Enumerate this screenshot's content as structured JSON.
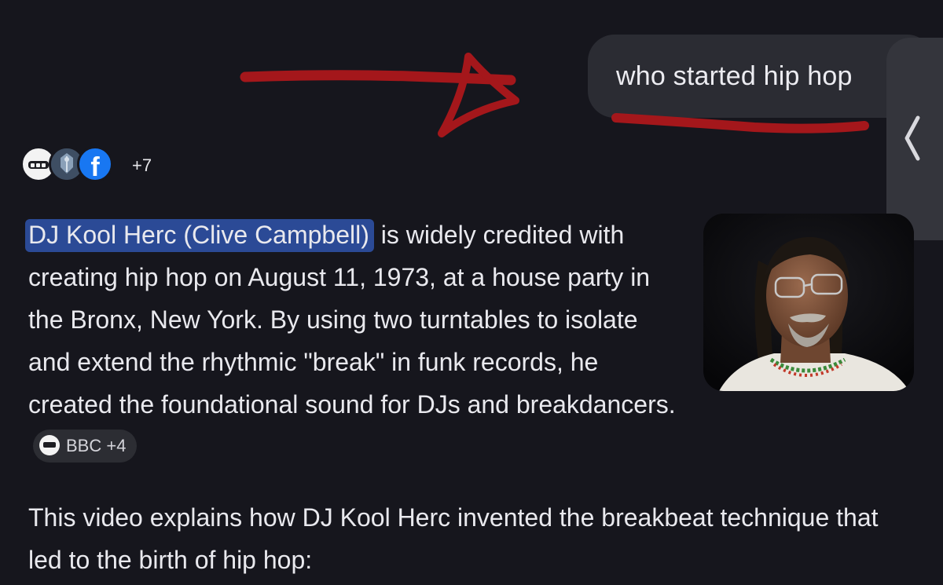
{
  "query": {
    "text": "who started hip hop"
  },
  "sources": {
    "icons": [
      "bbc-dots-icon",
      "crest-icon",
      "facebook-icon"
    ],
    "facebook_letter": "f",
    "more_count": "+7"
  },
  "answer": {
    "highlight": "DJ Kool Herc (Clive Campbell)",
    "text": " is widely credited with creating hip hop on August 11, 1973, at a house party in the Bronx, New York. By using two turntables to isolate and extend the rhythmic \"break\" in funk records, he created the foundational sound for DJs and breakdancers.",
    "citation": "BBC +4"
  },
  "video_intro": "This video explains how DJ Kool Herc invented the breakbeat technique that led to the birth of hip hop:",
  "colors": {
    "background": "#16161d",
    "bubble": "#2b2c33",
    "highlight": "#2b4a96",
    "annotation": "#a4171b",
    "facebook": "#1877f2"
  }
}
